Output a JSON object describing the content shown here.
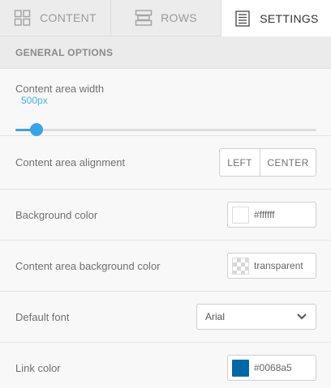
{
  "tabs": [
    {
      "label": "CONTENT",
      "icon": "grid-icon",
      "active": false
    },
    {
      "label": "ROWS",
      "icon": "rows-icon",
      "active": false
    },
    {
      "label": "SETTINGS",
      "icon": "document-icon",
      "active": true
    }
  ],
  "section": {
    "title": "GENERAL OPTIONS"
  },
  "content_width": {
    "label": "Content area width",
    "value": "500px",
    "slider_fraction": 0.07
  },
  "alignment": {
    "label": "Content area alignment",
    "options": [
      "LEFT",
      "CENTER"
    ]
  },
  "background_color": {
    "label": "Background color",
    "value": "#ffffff",
    "swatch": "#ffffff"
  },
  "content_bg_color": {
    "label": "Content area background color",
    "value": "transparent"
  },
  "default_font": {
    "label": "Default font",
    "value": "Arial"
  },
  "link_color": {
    "label": "Link color",
    "value": "#0068a5",
    "swatch": "#0068a5"
  },
  "colors": {
    "accent": "#3aa3e3",
    "active_tab_bg": "#ffffff",
    "inactive_tab_bg": "#ececec"
  }
}
